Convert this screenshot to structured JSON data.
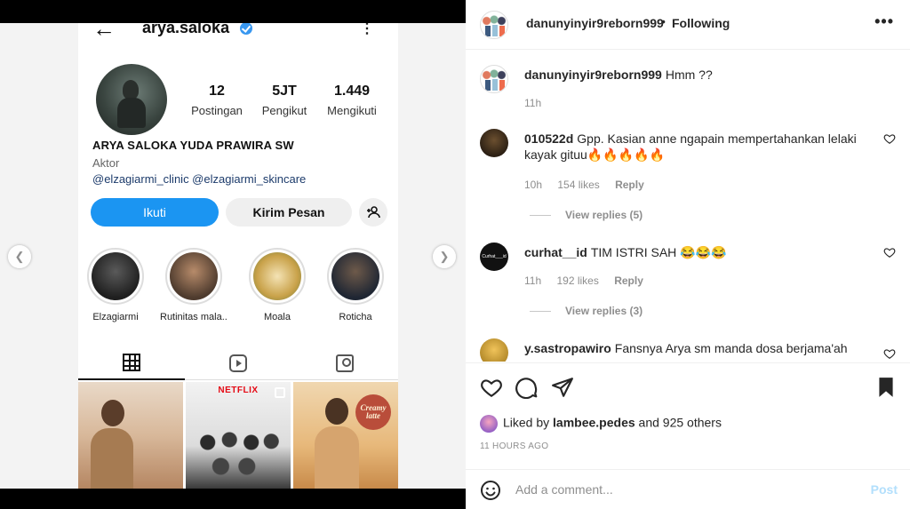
{
  "screenshot": {
    "header": {
      "username": "arya.saloka",
      "back_icon": "back-arrow-icon",
      "more_icon": "more-vertical-icon"
    },
    "stats": [
      {
        "num": "12",
        "label": "Postingan"
      },
      {
        "num": "5JT",
        "label": "Pengikut"
      },
      {
        "num": "1.449",
        "label": "Mengikuti"
      }
    ],
    "bio": {
      "fullname": "ARYA SALOKA YUDA PRAWIRA SW",
      "role": "Aktor",
      "links": "@elzagiarmi_clinic @elzagiarmi_skincare"
    },
    "buttons": {
      "follow": "Ikuti",
      "message": "Kirim Pesan",
      "add_user": "+&#8203;"
    },
    "highlights": [
      {
        "caption": "Elzagiarmi",
        "color": "#3a3a3a"
      },
      {
        "caption": "Rutinitas mala...",
        "color": "#7a5a45"
      },
      {
        "caption": "Moala",
        "color": "#d9b96a"
      },
      {
        "caption": "Roticha",
        "color": "#2e3f5a"
      }
    ],
    "tiles": {
      "tile2_brand": "NETFLIX",
      "tile3_logo": "Creamy latte"
    }
  },
  "post": {
    "owner": "danunyinyir9reborn999",
    "dot": "•",
    "following": "Following",
    "caption": {
      "user": "danunyinyir9reborn999",
      "text": "Hmm ??",
      "time": "11h"
    },
    "comments": [
      {
        "user": "010522d",
        "text": "Gpp. Kasian anne ngapain mempertahankan lelaki kayak gituu🔥🔥🔥🔥🔥",
        "time": "10h",
        "likes": "154 likes",
        "reply": "Reply",
        "view_replies": "View replies (5)"
      },
      {
        "user": "curhat__id",
        "text": "TIM ISTRI SAH 😂😂😂",
        "time": "11h",
        "likes": "192 likes",
        "reply": "Reply",
        "view_replies": "View replies (3)",
        "avatar_text": "Curhat___id"
      },
      {
        "user": "y.sastropawiro",
        "text": "Fansnya Arya sm manda dosa berjama'ah"
      }
    ],
    "liked_by": {
      "prefix": "Liked by",
      "user": "lambee.pedes",
      "suffix": "and 925 others"
    },
    "timestamp": "11 HOURS AGO",
    "add_comment": {
      "placeholder": "Add a comment...",
      "post_label": "Post"
    }
  }
}
